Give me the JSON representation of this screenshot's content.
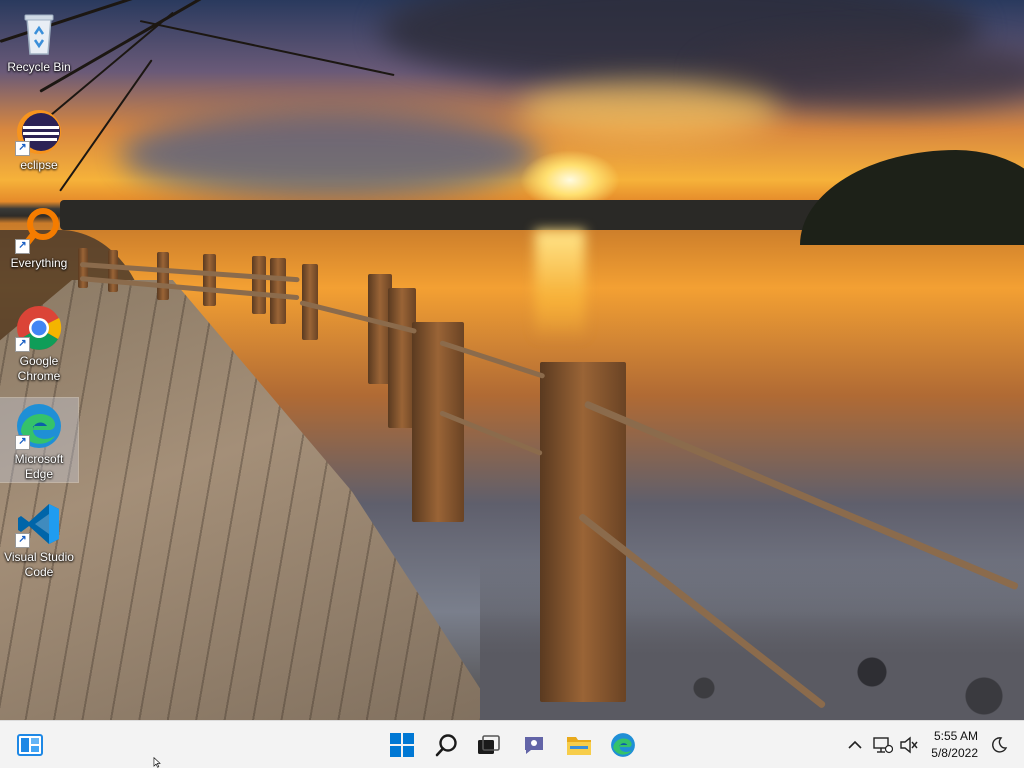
{
  "desktop": {
    "icons": [
      {
        "label": "Recycle Bin",
        "icon": "recycle-bin-icon",
        "shortcut": false
      },
      {
        "label": "eclipse",
        "icon": "eclipse-icon",
        "shortcut": true
      },
      {
        "label": "Everything",
        "icon": "everything-search-icon",
        "shortcut": true
      },
      {
        "label": "Google Chrome",
        "icon": "chrome-icon",
        "shortcut": true
      },
      {
        "label": "Microsoft Edge",
        "icon": "edge-icon",
        "shortcut": true,
        "selected": true
      },
      {
        "label": "Visual Studio Code",
        "icon": "vscode-icon",
        "shortcut": true
      }
    ]
  },
  "taskbar": {
    "pinned": [
      {
        "icon": "widgets-icon",
        "color": "#1e88e5"
      },
      {
        "icon": "windows-start-icon",
        "color": "#0078d4"
      },
      {
        "icon": "search-icon",
        "color": "#1a1a1a"
      },
      {
        "icon": "task-view-icon",
        "color": "#1a1a1a"
      },
      {
        "icon": "teams-chat-icon",
        "color": "#6264a7"
      },
      {
        "icon": "file-explorer-icon",
        "color": "#f4c542"
      },
      {
        "icon": "edge-icon",
        "color": "#1f8fd6"
      }
    ],
    "tray": {
      "time": "5:55 AM",
      "date": "5/8/2022",
      "icons": [
        "chevron-up-icon",
        "network-icon",
        "volume-muted-icon",
        "notification-moon-icon"
      ]
    }
  }
}
